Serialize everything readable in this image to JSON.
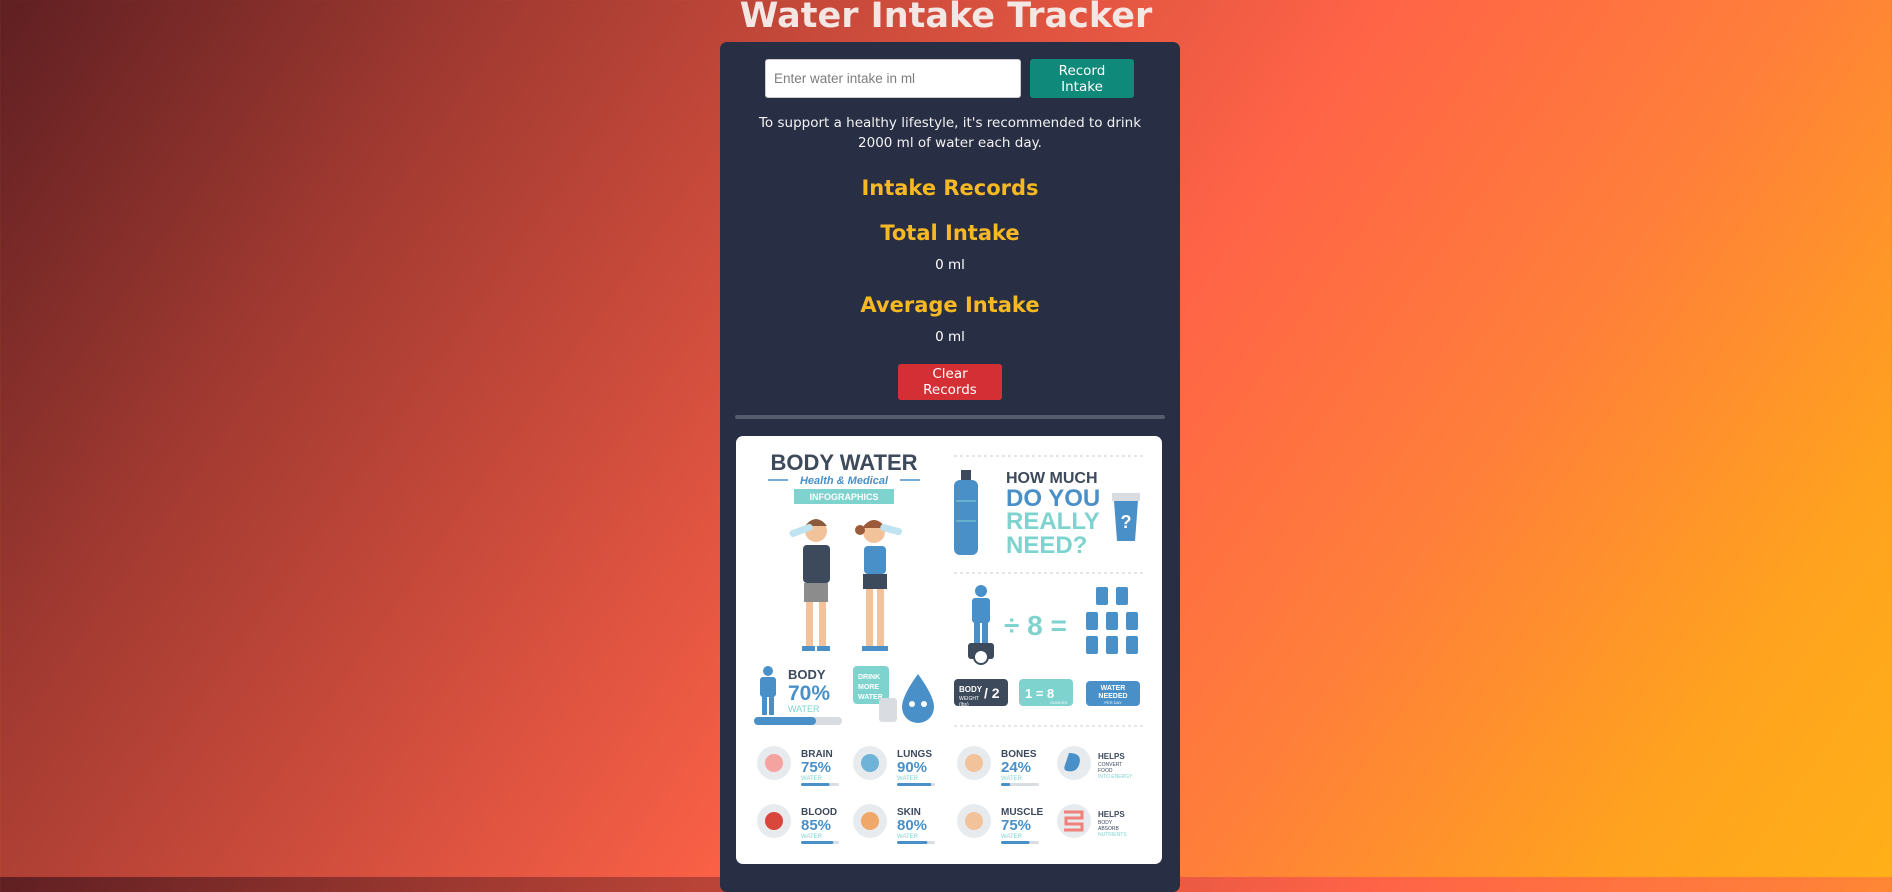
{
  "header": {
    "title": "Water Intake Tracker"
  },
  "form": {
    "placeholder": "Enter water intake in ml",
    "record_label": "Record Intake"
  },
  "recommendation": "To support a healthy lifestyle, it's recommended to drink 2000 ml of water each day.",
  "records": {
    "heading": "Intake Records",
    "total_heading": "Total Intake",
    "total_value": "0 ml",
    "average_heading": "Average Intake",
    "average_value": "0 ml",
    "clear_label": "Clear Records"
  },
  "infographic": {
    "title": "BODY WATER",
    "subtitle": "Health & Medical",
    "badge": "INFOGRAPHICS",
    "question_line1": "HOW MUCH",
    "question_line2": "DO YOU",
    "question_line3": "REALLY",
    "question_line4": "NEED?",
    "divide_by": "÷ 8 =",
    "body_weight": "BODY",
    "body_weight_small": "WEIGHT",
    "body_weight_unit": "(lbs)",
    "half": "/ 2",
    "glass_eq": "1 = 8",
    "glass_eq_small": "OUNCES",
    "water_needed": "WATER",
    "water_needed2": "NEEDED",
    "water_needed_small": "PER DAY",
    "body_label": "BODY",
    "body_pct": "70%",
    "water": "WATER",
    "drink_more": [
      "DRINK",
      "MORE",
      "WATER"
    ],
    "organs": [
      {
        "name": "BRAIN",
        "pct": "75%",
        "level": 0.75
      },
      {
        "name": "LUNGS",
        "pct": "90%",
        "level": 0.9
      },
      {
        "name": "BONES",
        "pct": "24%",
        "level": 0.24
      },
      {
        "name": "BLOOD",
        "pct": "85%",
        "level": 0.85
      },
      {
        "name": "SKIN",
        "pct": "80%",
        "level": 0.8
      },
      {
        "name": "MUSCLE",
        "pct": "75%",
        "level": 0.75
      }
    ],
    "helps1": [
      "HELPS",
      "CONVERT",
      "FOOD",
      "INTO ENERGY"
    ],
    "helps2": [
      "HELPS",
      "BODY",
      "ABSORB",
      "NUTRIENTS"
    ],
    "colors": {
      "blue": "#4a90c8",
      "teal": "#7fd3cf",
      "dark": "#3d4a5c",
      "grey": "#d9dde2"
    }
  }
}
